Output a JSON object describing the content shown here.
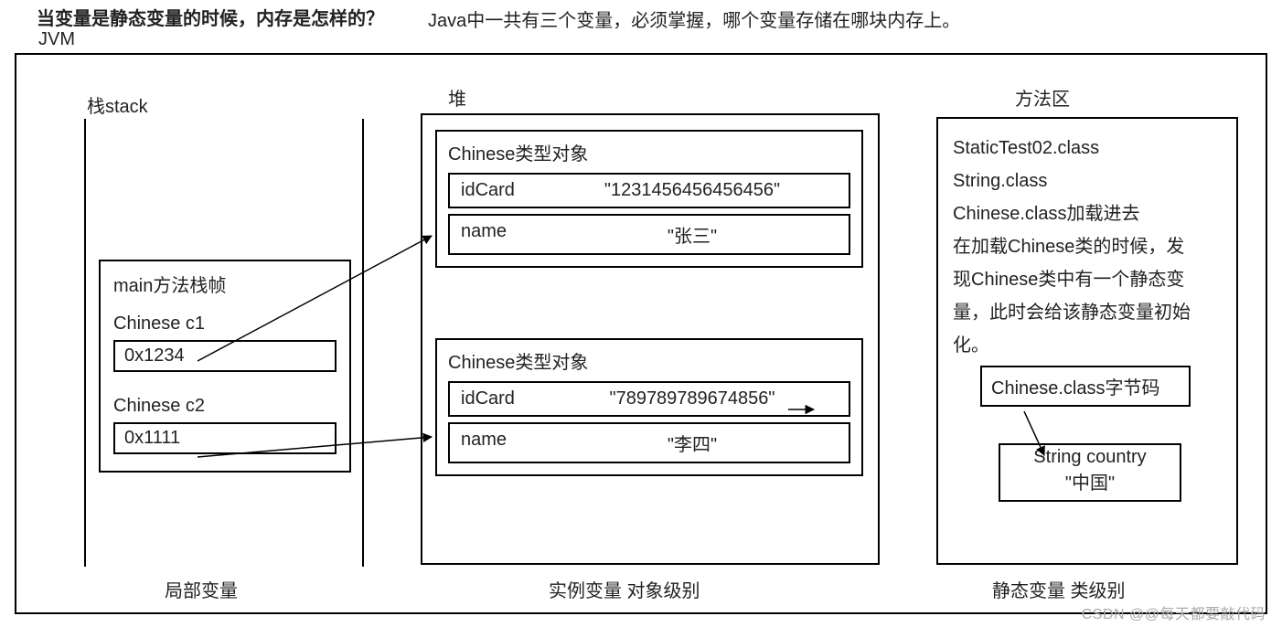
{
  "title_main": "当变量是静态变量的时候，内存是怎样的？",
  "title_sub": "Java中一共有三个变量，必须掌握，哪个变量存储在哪块内存上。",
  "jvm_label": "JVM",
  "stack": {
    "label": "栈stack",
    "frame_title": "main方法栈帧",
    "vars": [
      {
        "decl": "Chinese c1",
        "value": "0x1234"
      },
      {
        "decl": "Chinese c2",
        "value": "0x1111"
      }
    ],
    "caption": "局部变量"
  },
  "heap": {
    "label": "堆",
    "objects": [
      {
        "title": "Chinese类型对象",
        "fields": [
          {
            "name": "idCard",
            "value": "\"1231456456456456\""
          },
          {
            "name": "name",
            "value": "\"张三\""
          }
        ]
      },
      {
        "title": "Chinese类型对象",
        "fields": [
          {
            "name": "idCard",
            "value": "\"789789789674856\""
          },
          {
            "name": "name",
            "value": "\"李四\""
          }
        ]
      }
    ],
    "caption": "实例变量   对象级别"
  },
  "method_area": {
    "label": "方法区",
    "lines": [
      "StaticTest02.class",
      "String.class",
      "Chinese.class加载进去",
      "在加载Chinese类的时候，发",
      "现Chinese类中有一个静态变",
      "量，此时会给该静态变量初始",
      "化。"
    ],
    "class_box": "Chinese.class字节码",
    "static_var_title": "String country",
    "static_var_value": "\"中国\"",
    "caption": "静态变量   类级别"
  },
  "watermark": "CSDN @@每天都要敲代码"
}
